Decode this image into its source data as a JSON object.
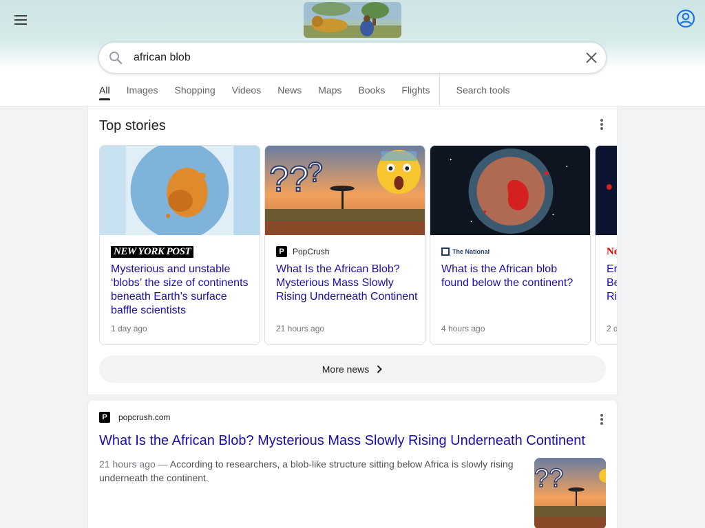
{
  "search": {
    "query": "african blob"
  },
  "tabs": [
    {
      "label": "All"
    },
    {
      "label": "Images"
    },
    {
      "label": "Shopping"
    },
    {
      "label": "Videos"
    },
    {
      "label": "News"
    },
    {
      "label": "Maps"
    },
    {
      "label": "Books"
    },
    {
      "label": "Flights"
    }
  ],
  "search_tools_label": "Search tools",
  "top_stories": {
    "title": "Top stories",
    "stories": [
      {
        "source": "NEW YORK POST",
        "title": "Mysterious and unstable ‘blobs’ the size of continents beneath Earth’s surface baffle scientists",
        "time": "1 day ago"
      },
      {
        "source": "PopCrush",
        "title": "What Is the African Blob? Mysterious Mass Slowly Rising Underneath Continent",
        "time": "21 hours ago"
      },
      {
        "source": "The National",
        "title": "What is the African blob found below the continent?",
        "time": "4 hours ago"
      },
      {
        "source": "Ne",
        "title": "En Be Ris",
        "time": "2 d"
      }
    ],
    "more_label": "More news"
  },
  "result": {
    "favicon_letter": "P",
    "domain": "popcrush.com",
    "title": "What Is the African Blob? Mysterious Mass Slowly Rising Underneath Continent",
    "date": "21 hours ago —",
    "snippet": "According to researchers, a blob-like structure sitting below Africa is slowly rising underneath the continent."
  },
  "colors": {
    "link": "#1a0dab",
    "header_bg": "#cfe4e4",
    "nyp_red": "#d60000"
  },
  "icons": [
    "menu-icon",
    "account-icon",
    "search-icon",
    "close-icon",
    "more-vert-icon",
    "chevron-right-icon"
  ]
}
